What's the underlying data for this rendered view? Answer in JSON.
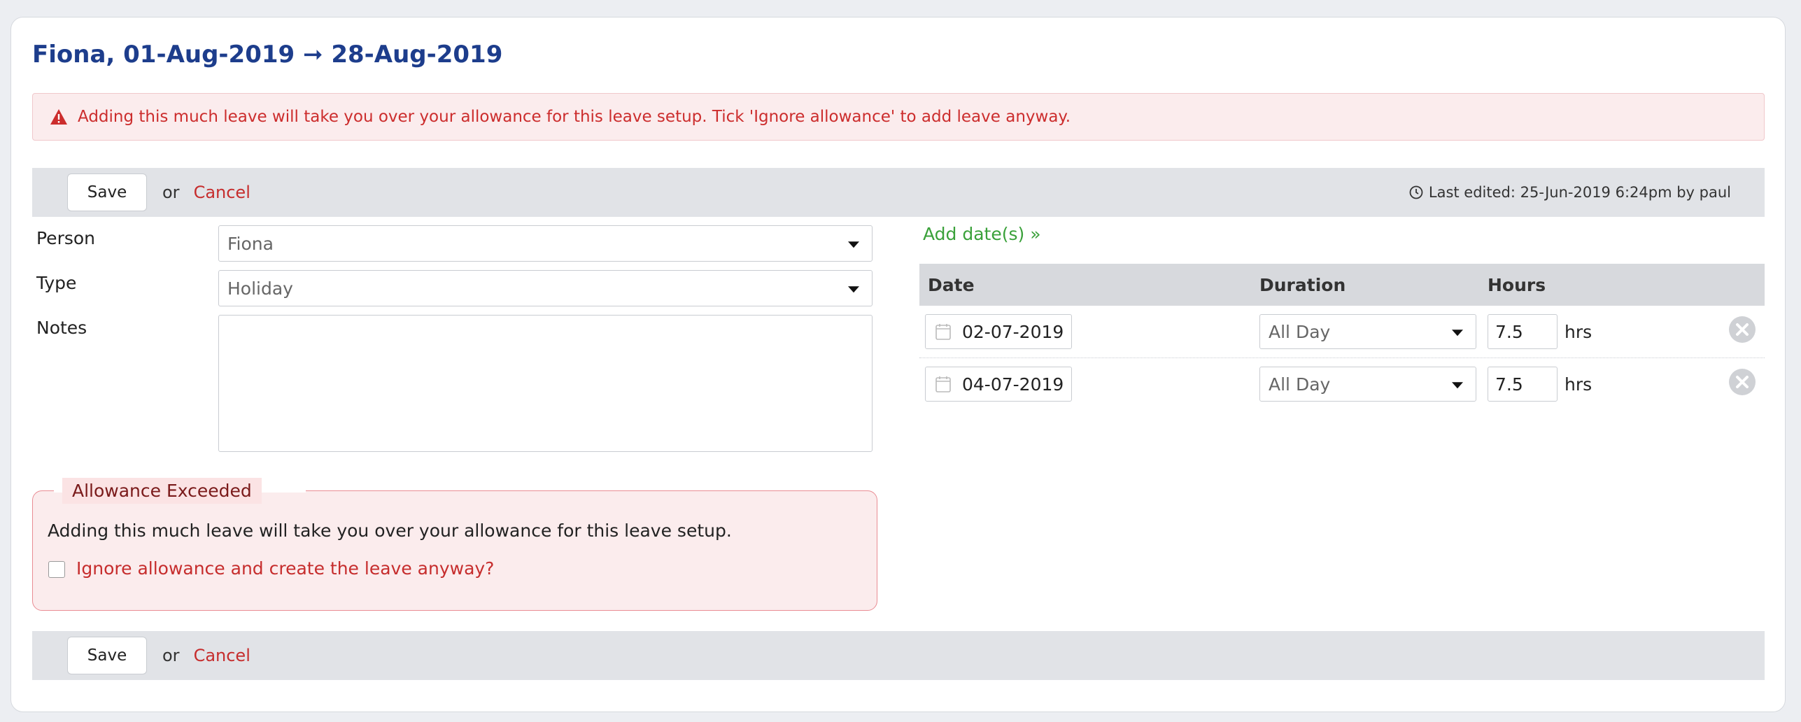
{
  "title": "Fiona, 01-Aug-2019 ➞ 28-Aug-2019",
  "alert": {
    "icon": "warning-triangle-icon",
    "text": "Adding this much leave will take you over your allowance for this leave setup. Tick 'Ignore allowance' to add leave anyway."
  },
  "toolbar": {
    "save_label": "Save",
    "or_label": "or",
    "cancel_label": "Cancel",
    "last_edited": "Last edited: 25-Jun-2019 6:24pm by paul"
  },
  "form": {
    "person_label": "Person",
    "person_value": "Fiona",
    "type_label": "Type",
    "type_value": "Holiday",
    "notes_label": "Notes",
    "notes_value": ""
  },
  "allowance": {
    "legend": "Allowance Exceeded",
    "message": "Adding this much leave will take you over your allowance for this leave setup.",
    "ignore_label": "Ignore allowance and create the leave anyway?",
    "ignore_checked": false
  },
  "dates": {
    "add_link": "Add date(s) »",
    "headers": {
      "date": "Date",
      "duration": "Duration",
      "hours": "Hours"
    },
    "rows": [
      {
        "date": "02-07-2019",
        "duration": "All Day",
        "hours": "7.5",
        "unit": "hrs"
      },
      {
        "date": "04-07-2019",
        "duration": "All Day",
        "hours": "7.5",
        "unit": "hrs"
      }
    ]
  },
  "colors": {
    "title": "#1d3d8c",
    "danger": "#c62d2d",
    "success": "#3aa13a",
    "alert_bg": "#fbeced"
  }
}
